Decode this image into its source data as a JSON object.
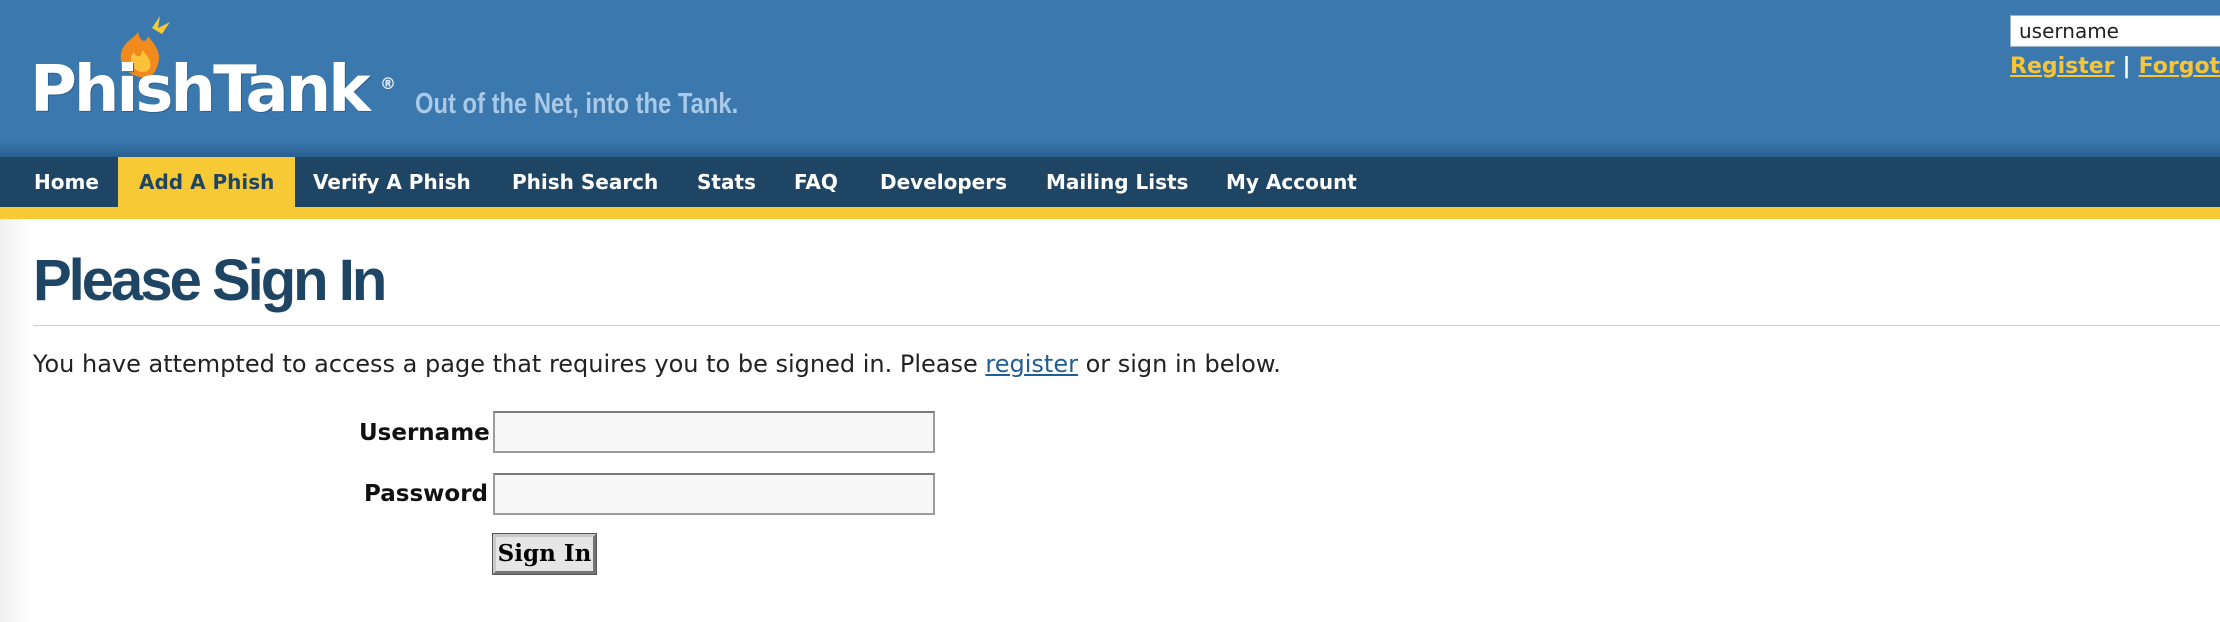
{
  "header": {
    "logo_text": "PhishTank",
    "logo_mark": "®",
    "tagline": "Out of the Net, into the Tank.",
    "login": {
      "username_value": "username",
      "register_link": "Register",
      "separator": "|",
      "forgot_link": "Forgot"
    },
    "brand_color": "#3a78ae",
    "accent_color": "#f7c935"
  },
  "nav": {
    "items": [
      {
        "label": "Home"
      },
      {
        "label": "Add A Phish",
        "active": true
      },
      {
        "label": "Verify A Phish"
      },
      {
        "label": "Phish Search"
      },
      {
        "label": "Stats"
      },
      {
        "label": "FAQ"
      },
      {
        "label": "Developers"
      },
      {
        "label": "Mailing Lists"
      },
      {
        "label": "My Account"
      }
    ]
  },
  "main": {
    "title": "Please Sign In",
    "intro_before": "You have attempted to access a page that requires you to be signed in. Please ",
    "intro_link": "register",
    "intro_after": " or sign in below.",
    "form": {
      "username_label": "Username",
      "username_value": "",
      "password_label": "Password",
      "password_value": "",
      "submit_label": "Sign In"
    }
  }
}
